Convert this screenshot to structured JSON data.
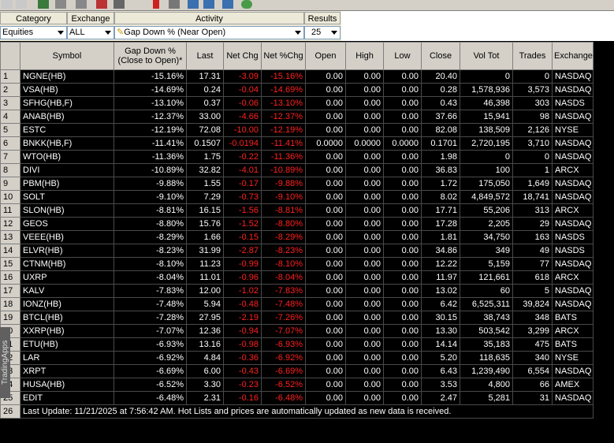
{
  "filters": {
    "category": {
      "label": "Category",
      "value": "Equities"
    },
    "exchange": {
      "label": "Exchange",
      "value": "ALL"
    },
    "activity": {
      "label": "Activity",
      "value": "Gap Down % (Near Open)"
    },
    "results": {
      "label": "Results",
      "value": "25"
    }
  },
  "columns": [
    "",
    "Symbol",
    "Gap Down %\n(Close to Open)*",
    "Last",
    "Net Chg",
    "Net %Chg",
    "Open",
    "High",
    "Low",
    "Close",
    "Vol Tot",
    "Trades",
    "Exchange"
  ],
  "rows": [
    [
      "1",
      "NGNE(HB)",
      "-15.16%",
      "17.31",
      "-3.09",
      "-15.16%",
      "0.00",
      "0.00",
      "0.00",
      "20.40",
      "0",
      "0",
      "NASDAQ"
    ],
    [
      "2",
      "VSA(HB)",
      "-14.69%",
      "0.24",
      "-0.04",
      "-14.69%",
      "0.00",
      "0.00",
      "0.00",
      "0.28",
      "1,578,936",
      "3,573",
      "NASDAQ"
    ],
    [
      "3",
      "SFHG(HB,F)",
      "-13.10%",
      "0.37",
      "-0.06",
      "-13.10%",
      "0.00",
      "0.00",
      "0.00",
      "0.43",
      "46,398",
      "303",
      "NASDS"
    ],
    [
      "4",
      "ANAB(HB)",
      "-12.37%",
      "33.00",
      "-4.66",
      "-12.37%",
      "0.00",
      "0.00",
      "0.00",
      "37.66",
      "15,941",
      "98",
      "NASDAQ"
    ],
    [
      "5",
      "ESTC",
      "-12.19%",
      "72.08",
      "-10.00",
      "-12.19%",
      "0.00",
      "0.00",
      "0.00",
      "82.08",
      "138,509",
      "2,126",
      "NYSE"
    ],
    [
      "6",
      "BNKK(HB,F)",
      "-11.41%",
      "0.1507",
      "-0.0194",
      "-11.41%",
      "0.0000",
      "0.0000",
      "0.0000",
      "0.1701",
      "2,720,195",
      "3,710",
      "NASDAQ"
    ],
    [
      "7",
      "WTO(HB)",
      "-11.36%",
      "1.75",
      "-0.22",
      "-11.36%",
      "0.00",
      "0.00",
      "0.00",
      "1.98",
      "0",
      "0",
      "NASDAQ"
    ],
    [
      "8",
      "DIVI",
      "-10.89%",
      "32.82",
      "-4.01",
      "-10.89%",
      "0.00",
      "0.00",
      "0.00",
      "36.83",
      "100",
      "1",
      "ARCX"
    ],
    [
      "9",
      "PBM(HB)",
      "-9.88%",
      "1.55",
      "-0.17",
      "-9.88%",
      "0.00",
      "0.00",
      "0.00",
      "1.72",
      "175,050",
      "1,649",
      "NASDAQ"
    ],
    [
      "10",
      "SOLT",
      "-9.10%",
      "7.29",
      "-0.73",
      "-9.10%",
      "0.00",
      "0.00",
      "0.00",
      "8.02",
      "4,849,572",
      "18,741",
      "NASDAQ"
    ],
    [
      "11",
      "SLON(HB)",
      "-8.81%",
      "16.15",
      "-1.56",
      "-8.81%",
      "0.00",
      "0.00",
      "0.00",
      "17.71",
      "55,206",
      "313",
      "ARCX"
    ],
    [
      "12",
      "GEOS",
      "-8.80%",
      "15.76",
      "-1.52",
      "-8.80%",
      "0.00",
      "0.00",
      "0.00",
      "17.28",
      "2,205",
      "29",
      "NASDAQ"
    ],
    [
      "13",
      "VEEE(HB)",
      "-8.29%",
      "1.66",
      "-0.15",
      "-8.29%",
      "0.00",
      "0.00",
      "0.00",
      "1.81",
      "34,750",
      "163",
      "NASDS"
    ],
    [
      "14",
      "ELVR(HB)",
      "-8.23%",
      "31.99",
      "-2.87",
      "-8.23%",
      "0.00",
      "0.00",
      "0.00",
      "34.86",
      "349",
      "49",
      "NASDS"
    ],
    [
      "15",
      "CTNM(HB)",
      "-8.10%",
      "11.23",
      "-0.99",
      "-8.10%",
      "0.00",
      "0.00",
      "0.00",
      "12.22",
      "5,159",
      "77",
      "NASDAQ"
    ],
    [
      "16",
      "UXRP",
      "-8.04%",
      "11.01",
      "-0.96",
      "-8.04%",
      "0.00",
      "0.00",
      "0.00",
      "11.97",
      "121,661",
      "618",
      "ARCX"
    ],
    [
      "17",
      "KALV",
      "-7.83%",
      "12.00",
      "-1.02",
      "-7.83%",
      "0.00",
      "0.00",
      "0.00",
      "13.02",
      "60",
      "5",
      "NASDAQ"
    ],
    [
      "18",
      "IONZ(HB)",
      "-7.48%",
      "5.94",
      "-0.48",
      "-7.48%",
      "0.00",
      "0.00",
      "0.00",
      "6.42",
      "6,525,311",
      "39,824",
      "NASDAQ"
    ],
    [
      "19",
      "BTCL(HB)",
      "-7.28%",
      "27.95",
      "-2.19",
      "-7.26%",
      "0.00",
      "0.00",
      "0.00",
      "30.15",
      "38,743",
      "348",
      "BATS"
    ],
    [
      "20",
      "XXRP(HB)",
      "-7.07%",
      "12.36",
      "-0.94",
      "-7.07%",
      "0.00",
      "0.00",
      "0.00",
      "13.30",
      "503,542",
      "3,299",
      "ARCX"
    ],
    [
      "21",
      "ETU(HB)",
      "-6.93%",
      "13.16",
      "-0.98",
      "-6.93%",
      "0.00",
      "0.00",
      "0.00",
      "14.14",
      "35,183",
      "475",
      "BATS"
    ],
    [
      "22",
      "LAR",
      "-6.92%",
      "4.84",
      "-0.36",
      "-6.92%",
      "0.00",
      "0.00",
      "0.00",
      "5.20",
      "118,635",
      "340",
      "NYSE"
    ],
    [
      "23",
      "XRPT",
      "-6.69%",
      "6.00",
      "-0.43",
      "-6.69%",
      "0.00",
      "0.00",
      "0.00",
      "6.43",
      "1,239,490",
      "6,554",
      "NASDAQ"
    ],
    [
      "24",
      "HUSA(HB)",
      "-6.52%",
      "3.30",
      "-0.23",
      "-6.52%",
      "0.00",
      "0.00",
      "0.00",
      "3.53",
      "4,800",
      "66",
      "AMEX"
    ],
    [
      "25",
      "EDIT",
      "-6.48%",
      "2.31",
      "-0.16",
      "-6.48%",
      "0.00",
      "0.00",
      "0.00",
      "2.47",
      "5,281",
      "31",
      "NASDAQ"
    ]
  ],
  "status": {
    "row_number": "26",
    "text": "Last Update: 11/21/2025 at 7:56:42 AM.  Hot Lists and prices are automatically updated as new data is received."
  },
  "side_tab": "TradingApps",
  "colors": {
    "negative": "#ff2020",
    "background": "#000000",
    "header": "#d4d0c8"
  }
}
